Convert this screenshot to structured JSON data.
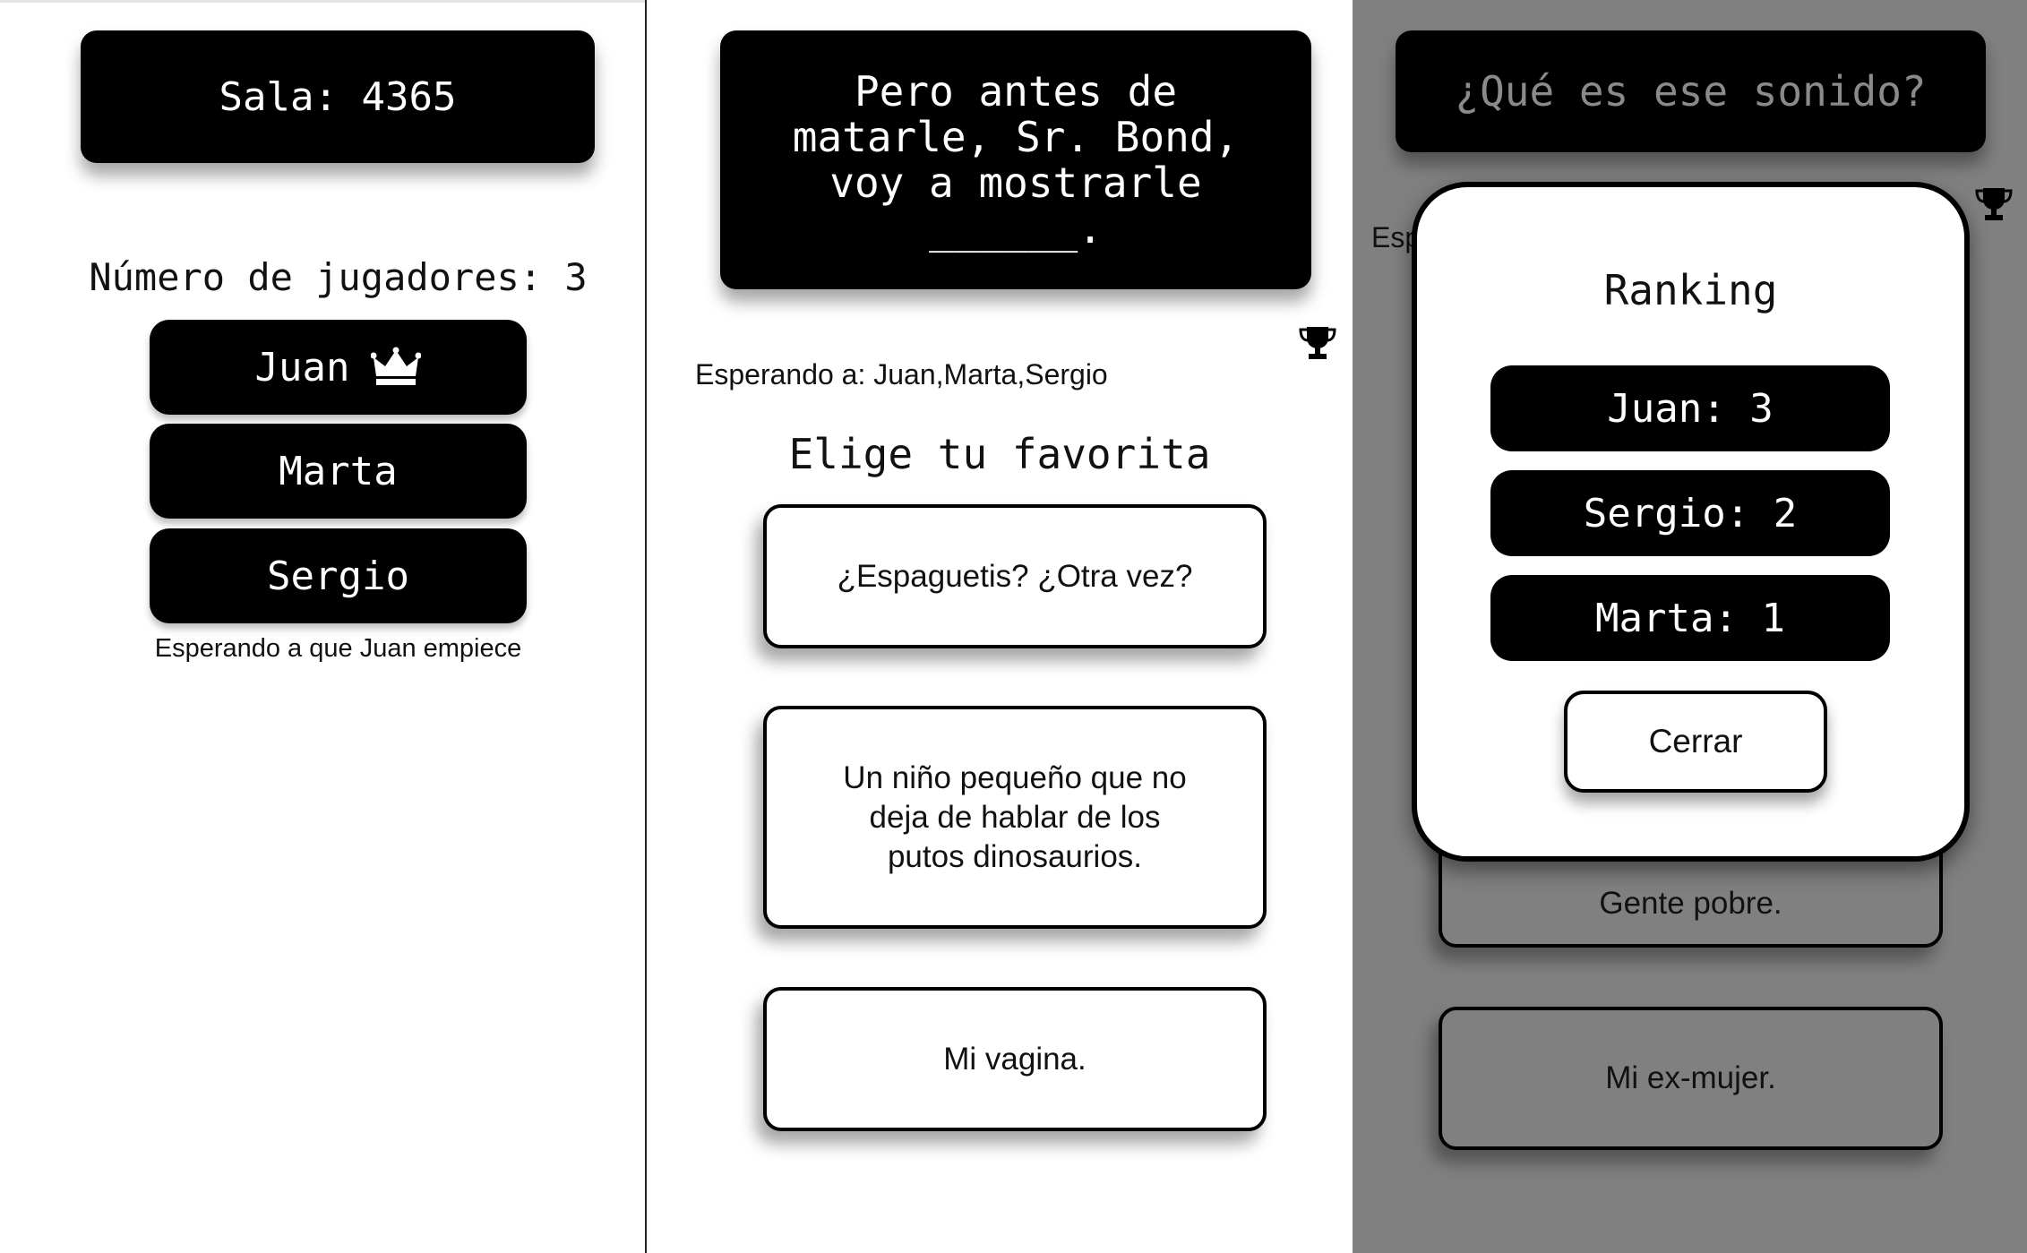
{
  "lobby": {
    "room_label": "Sala: 4365",
    "players_count_label": "Número de jugadores: 3",
    "players": [
      {
        "name": "Juan",
        "is_host": true
      },
      {
        "name": "Marta",
        "is_host": false
      },
      {
        "name": "Sergio",
        "is_host": false
      }
    ],
    "host_icon": "crown-icon",
    "waiting_text": "Esperando a que Juan empiece"
  },
  "vote": {
    "prompt_lines": [
      "Pero antes de",
      "matarle, Sr. Bond,",
      "voy a mostrarle",
      "______."
    ],
    "trophy_icon": "trophy-icon",
    "waiting_text": "Esperando a: Juan,Marta,Sergio",
    "choose_title": "Elige tu favorita",
    "answers": [
      {
        "lines": [
          "¿Espaguetis? ¿Otra vez?"
        ]
      },
      {
        "lines": [
          "Un niño pequeño que no",
          "deja de hablar de los",
          "putos dinosaurios."
        ]
      },
      {
        "lines": [
          "Mi vagina."
        ]
      }
    ]
  },
  "ranking_screen": {
    "question": "¿Qué es ese sonido?",
    "trophy_icon": "trophy-icon",
    "waiting_text_clipped": "Esp",
    "background_answers": [
      "Gente pobre.",
      "Mi ex-mujer."
    ],
    "modal": {
      "title": "Ranking",
      "entries": [
        "Juan: 3",
        "Sergio: 2",
        "Marta: 1"
      ],
      "close_label": "Cerrar"
    }
  },
  "colors": {
    "card_black": "#000000",
    "overlay_gray": "#808080",
    "card_white": "#ffffff",
    "muted_text": "#8a8a8a"
  }
}
